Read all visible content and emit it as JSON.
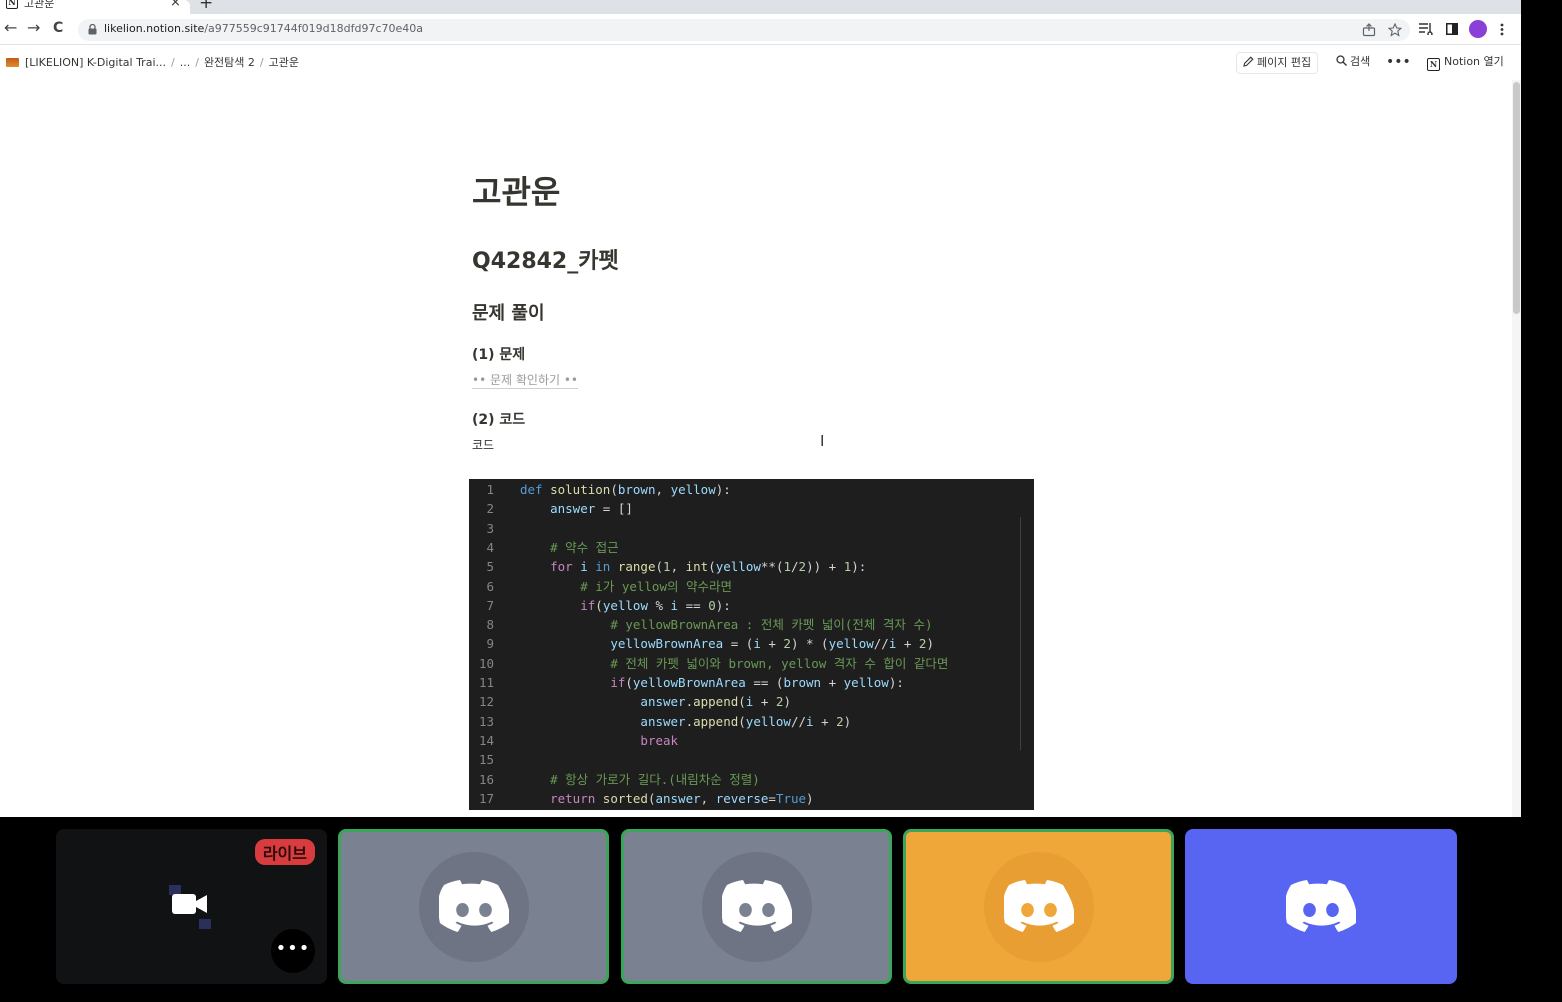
{
  "browser": {
    "tab_title": "고관운",
    "tab_close": "×",
    "new_tab": "+",
    "back": "←",
    "forward": "→",
    "reload": "C",
    "url_host": "likelion.notion.site",
    "url_path": "/a977559c91744f019d18dfd97c70e40a"
  },
  "notion": {
    "breadcrumb": [
      "[LIKELION] K-Digital Trai...",
      "...",
      "완전탐색 2",
      "고관운"
    ],
    "edit_label": "페이지 편집",
    "search_label": "검색",
    "more_label": "•••",
    "open_label": "Notion 열기",
    "logo_letter": "N"
  },
  "page": {
    "title": "고관운",
    "heading1": "Q42842_카펫",
    "heading2": "문제 풀이",
    "section1": "(1) 문제",
    "link_problem": "•• 문제 확인하기 ••",
    "section2": "(2) 코드",
    "code_label": "코드"
  },
  "code": {
    "line_numbers": [
      "1",
      "2",
      "3",
      "4",
      "5",
      "6",
      "7",
      "8",
      "9",
      "10",
      "11",
      "12",
      "13",
      "14",
      "15",
      "16",
      "17"
    ],
    "lines": [
      [
        [
          "kw",
          "def "
        ],
        [
          "fn",
          "solution"
        ],
        [
          "op",
          "("
        ],
        [
          "var",
          "brown"
        ],
        [
          "op",
          ", "
        ],
        [
          "var",
          "yellow"
        ],
        [
          "op",
          "):"
        ]
      ],
      [
        [
          "op",
          "    "
        ],
        [
          "var",
          "answer"
        ],
        [
          "op",
          " = []"
        ]
      ],
      [],
      [
        [
          "op",
          "    "
        ],
        [
          "cm",
          "# 약수 접근"
        ]
      ],
      [
        [
          "op",
          "    "
        ],
        [
          "ctl",
          "for "
        ],
        [
          "var",
          "i"
        ],
        [
          "kw",
          " in "
        ],
        [
          "fn",
          "range"
        ],
        [
          "op",
          "("
        ],
        [
          "num",
          "1"
        ],
        [
          "op",
          ", "
        ],
        [
          "fn",
          "int"
        ],
        [
          "op",
          "("
        ],
        [
          "var",
          "yellow"
        ],
        [
          "op",
          "**("
        ],
        [
          "num",
          "1"
        ],
        [
          "op",
          "/"
        ],
        [
          "num",
          "2"
        ],
        [
          "op",
          ")) + "
        ],
        [
          "num",
          "1"
        ],
        [
          "op",
          "):"
        ]
      ],
      [
        [
          "op",
          "        "
        ],
        [
          "cm",
          "# i가 yellow의 약수라면"
        ]
      ],
      [
        [
          "op",
          "        "
        ],
        [
          "ctl",
          "if"
        ],
        [
          "op",
          "("
        ],
        [
          "var",
          "yellow"
        ],
        [
          "op",
          " % "
        ],
        [
          "var",
          "i"
        ],
        [
          "op",
          " == "
        ],
        [
          "num",
          "0"
        ],
        [
          "op",
          "):"
        ]
      ],
      [
        [
          "op",
          "            "
        ],
        [
          "cm",
          "# yellowBrownArea : 전체 카펫 넓이(전체 격자 수)"
        ]
      ],
      [
        [
          "op",
          "            "
        ],
        [
          "var",
          "yellowBrownArea"
        ],
        [
          "op",
          " = ("
        ],
        [
          "var",
          "i"
        ],
        [
          "op",
          " + "
        ],
        [
          "num",
          "2"
        ],
        [
          "op",
          ") * ("
        ],
        [
          "var",
          "yellow"
        ],
        [
          "op",
          "//"
        ],
        [
          "var",
          "i"
        ],
        [
          "op",
          " + "
        ],
        [
          "num",
          "2"
        ],
        [
          "op",
          ")"
        ]
      ],
      [
        [
          "op",
          "            "
        ],
        [
          "cm",
          "# 전체 카펫 넓이와 brown, yellow 격자 수 합이 같다면"
        ]
      ],
      [
        [
          "op",
          "            "
        ],
        [
          "ctl",
          "if"
        ],
        [
          "op",
          "("
        ],
        [
          "var",
          "yellowBrownArea"
        ],
        [
          "op",
          " == ("
        ],
        [
          "var",
          "brown"
        ],
        [
          "op",
          " + "
        ],
        [
          "var",
          "yellow"
        ],
        [
          "op",
          "):"
        ]
      ],
      [
        [
          "op",
          "                "
        ],
        [
          "var",
          "answer"
        ],
        [
          "op",
          "."
        ],
        [
          "fn",
          "append"
        ],
        [
          "op",
          "("
        ],
        [
          "var",
          "i"
        ],
        [
          "op",
          " + "
        ],
        [
          "num",
          "2"
        ],
        [
          "op",
          ")"
        ]
      ],
      [
        [
          "op",
          "                "
        ],
        [
          "var",
          "answer"
        ],
        [
          "op",
          "."
        ],
        [
          "fn",
          "append"
        ],
        [
          "op",
          "("
        ],
        [
          "var",
          "yellow"
        ],
        [
          "op",
          "//"
        ],
        [
          "var",
          "i"
        ],
        [
          "op",
          " + "
        ],
        [
          "num",
          "2"
        ],
        [
          "op",
          ")"
        ]
      ],
      [
        [
          "op",
          "                "
        ],
        [
          "ctl",
          "break"
        ]
      ],
      [],
      [
        [
          "op",
          "    "
        ],
        [
          "cm",
          "# 항상 가로가 길다.(내림차순 정렬)"
        ]
      ],
      [
        [
          "op",
          "    "
        ],
        [
          "ctl",
          "return "
        ],
        [
          "fn",
          "sorted"
        ],
        [
          "op",
          "("
        ],
        [
          "var",
          "answer"
        ],
        [
          "op",
          ", "
        ],
        [
          "var",
          "reverse"
        ],
        [
          "op",
          "="
        ],
        [
          "kw",
          "True"
        ],
        [
          "op",
          ")"
        ]
      ]
    ]
  },
  "call": {
    "live_label": "라이브",
    "more_label": "•••",
    "tiles": [
      {
        "color": "#7a8191",
        "speaking": true
      },
      {
        "color": "#7a8191",
        "speaking": true
      },
      {
        "color": "#f0a73a",
        "speaking": true
      },
      {
        "color": "#5865f2",
        "speaking": false
      }
    ]
  }
}
